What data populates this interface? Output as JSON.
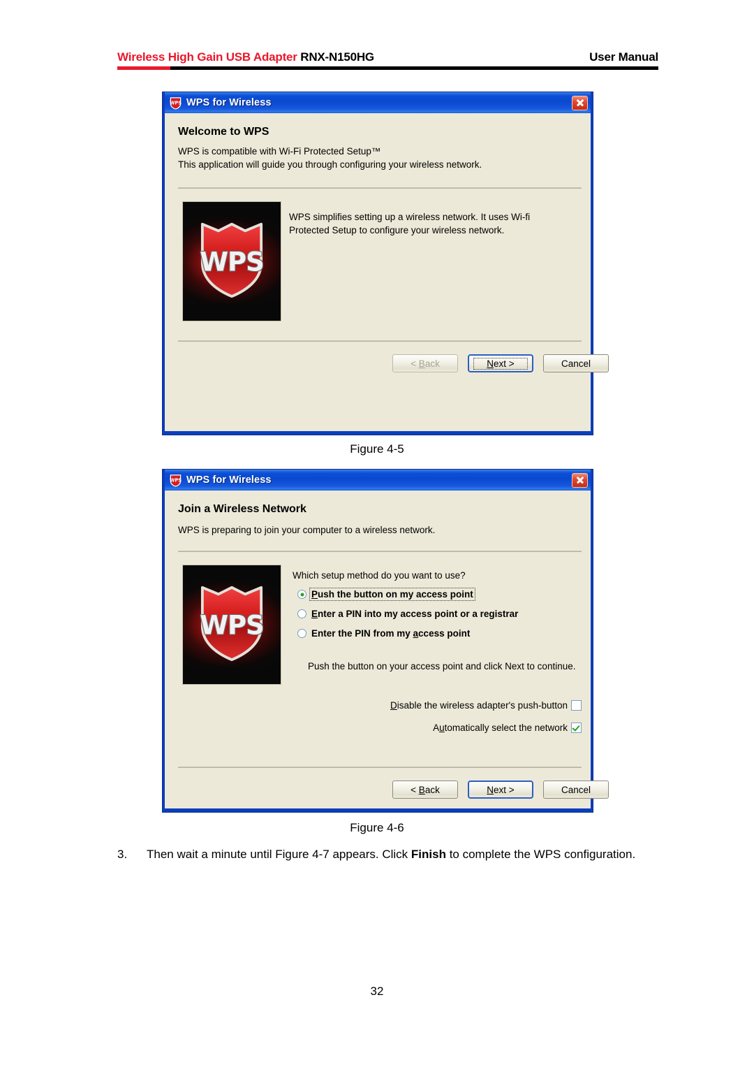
{
  "header": {
    "title_red": "Wireless High Gain USB Adapter",
    "title_black": " RNX-N150HG",
    "right": "User Manual",
    "accent_red": "#e8192c",
    "rule_color": "#000000"
  },
  "dialog1": {
    "titlebar": {
      "icon": "wps-shield-icon",
      "title": "WPS for Wireless",
      "close_label": "x"
    },
    "heading": "Welcome to WPS",
    "subtext": "WPS is compatible with Wi-Fi Protected Setup™\nThis application will guide you through configuring your wireless network.",
    "logo_text": "WPS",
    "body_text": "WPS simplifies setting up a wireless network. It uses Wi-fi Protected Setup to configure your wireless network.",
    "buttons": {
      "back": "< Back",
      "back_accel": "B",
      "next": "Next >",
      "next_accel": "N",
      "cancel": "Cancel",
      "back_enabled": false,
      "default_button": "next"
    }
  },
  "figure1_caption": "Figure 4-5",
  "dialog2": {
    "titlebar": {
      "icon": "wps-shield-icon",
      "title": "WPS for Wireless",
      "close_label": "x"
    },
    "heading": "Join a Wireless Network",
    "subtext": "WPS is preparing to join your computer to a wireless network.",
    "logo_text": "WPS",
    "question": "Which setup method do you want to use?",
    "radio_options": [
      {
        "label": "Push the button on my access point",
        "accel": "P",
        "selected": true,
        "focused": true
      },
      {
        "label": "Enter a PIN into my access point or a registrar",
        "accel": "E",
        "selected": false,
        "focused": false
      },
      {
        "label": "Enter the PIN from my access point",
        "accel": "a",
        "selected": false,
        "focused": false
      }
    ],
    "hint": "Push the button on your access point and click Next to continue.",
    "checkboxes": [
      {
        "label": "Disable the wireless adapter's push-button",
        "accel": "D",
        "checked": false
      },
      {
        "label": "Automatically select the network",
        "accel": "u",
        "checked": true
      }
    ],
    "buttons": {
      "back": "< Back",
      "back_accel": "B",
      "next": "Next >",
      "next_accel": "N",
      "cancel": "Cancel",
      "back_enabled": true,
      "default_button": "next"
    }
  },
  "figure2_caption": "Figure 4-6",
  "paragraph": {
    "number": "3.",
    "part1": "Then wait a minute until Figure 4-7 appears. Click ",
    "bold": "Finish",
    "part2": " to complete the WPS configuration."
  },
  "page_number": "32"
}
